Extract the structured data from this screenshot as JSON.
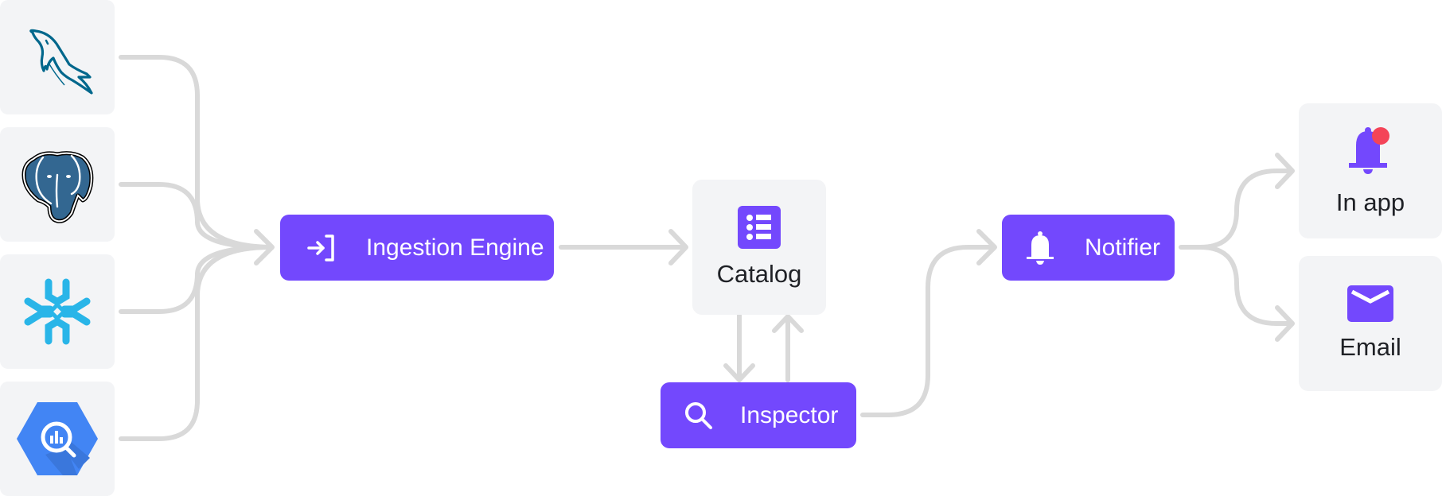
{
  "diagram": {
    "sources": [
      {
        "id": "mysql",
        "name": "MySQL",
        "icon": "mysql-dolphin-icon"
      },
      {
        "id": "postgresql",
        "name": "PostgreSQL",
        "icon": "postgresql-elephant-icon"
      },
      {
        "id": "snowflake",
        "name": "Snowflake",
        "icon": "snowflake-icon"
      },
      {
        "id": "bigquery",
        "name": "BigQuery",
        "icon": "bigquery-icon"
      }
    ],
    "nodes": {
      "ingestion": {
        "label": "Ingestion Engine",
        "icon": "sign-in-icon"
      },
      "catalog": {
        "label": "Catalog",
        "icon": "list-icon"
      },
      "inspector": {
        "label": "Inspector",
        "icon": "search-icon"
      },
      "notifier": {
        "label": "Notifier",
        "icon": "bell-icon"
      },
      "in_app": {
        "label": "In app",
        "icon": "bell-notification-icon"
      },
      "email": {
        "label": "Email",
        "icon": "envelope-icon"
      }
    },
    "edges": [
      {
        "from": "mysql",
        "to": "ingestion"
      },
      {
        "from": "postgresql",
        "to": "ingestion"
      },
      {
        "from": "snowflake",
        "to": "ingestion"
      },
      {
        "from": "bigquery",
        "to": "ingestion"
      },
      {
        "from": "ingestion",
        "to": "catalog"
      },
      {
        "from": "catalog",
        "to": "inspector"
      },
      {
        "from": "inspector",
        "to": "catalog"
      },
      {
        "from": "inspector",
        "to": "notifier"
      },
      {
        "from": "notifier",
        "to": "in_app"
      },
      {
        "from": "notifier",
        "to": "email"
      }
    ]
  },
  "colors": {
    "accent": "#7348fd",
    "card_bg": "#f3f4f6",
    "wire": "#d9d9d9",
    "badge": "#f44458",
    "text": "#1f2126"
  }
}
